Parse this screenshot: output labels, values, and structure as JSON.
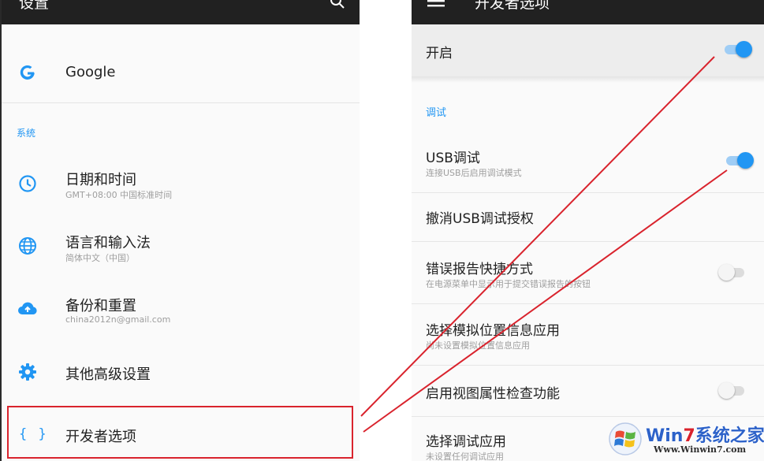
{
  "left": {
    "title": "设置",
    "google": {
      "title": "Google"
    },
    "section": "系统",
    "items": [
      {
        "title": "日期和时间",
        "sub": "GMT+08:00 中国标准时间"
      },
      {
        "title": "语言和输入法",
        "sub": "简体中文（中国）"
      },
      {
        "title": "备份和重置",
        "sub": "china2012n@gmail.com"
      },
      {
        "title": "其他高级设置"
      },
      {
        "title": "开发者选项"
      }
    ],
    "brace_icon": "{ }"
  },
  "right": {
    "title": "开发者选项",
    "master": {
      "label": "开启",
      "on": true
    },
    "section": "调试",
    "items": [
      {
        "title": "USB调试",
        "sub": "连接USB后启用调试模式",
        "toggle": "on"
      },
      {
        "title": "撤消USB调试授权"
      },
      {
        "title": "错误报告快捷方式",
        "sub": "在电源菜单中显示用于提交错误报告的按钮",
        "toggle": "off"
      },
      {
        "title": "选择模拟位置信息应用",
        "sub": "尚未设置模拟位置信息应用"
      },
      {
        "title": "启用视图属性检查功能",
        "toggle": "off"
      },
      {
        "title": "选择调试应用",
        "sub": "未设置任何调试应用"
      }
    ]
  },
  "watermark": {
    "name_a": "Win",
    "name_7": "7",
    "name_b": "系统之家",
    "url": "Www.Winwin7.com"
  },
  "colors": {
    "accent": "#2196f3",
    "annotation": "#d9232d",
    "appbar": "#212121"
  },
  "icons": [
    "search-icon",
    "google-icon",
    "clock-icon",
    "globe-icon",
    "cloud-upload-icon",
    "gear-icon",
    "braces-icon",
    "menu-icon"
  ]
}
